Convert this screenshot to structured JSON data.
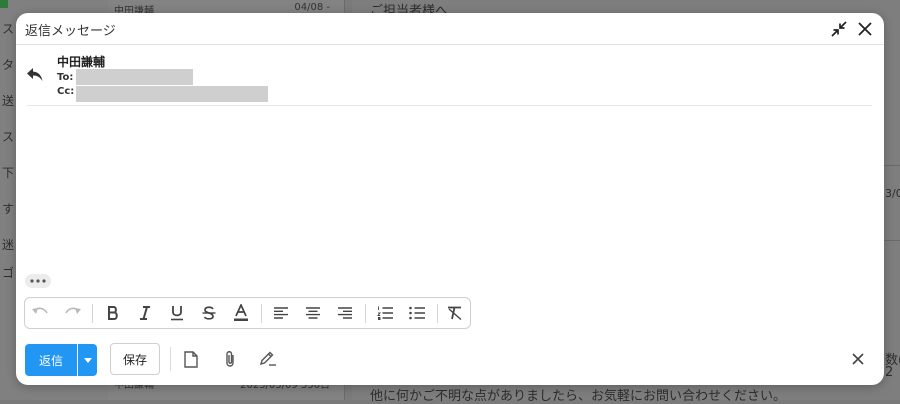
{
  "background": {
    "sidebar_items": [
      "ス",
      "タ",
      "送",
      "ス",
      "下",
      "す",
      "迷",
      "ゴ"
    ],
    "list_items": [
      {
        "name": "中田謙輔",
        "date": "04/08 -"
      },
      {
        "name": "中田謙輔",
        "date": "2023/03/09 336日"
      }
    ],
    "preview_lines": [
      "ご担当者様へ",
      "他に何かご不明な点がありましたら、お気軽にお問い合わせください。"
    ],
    "right_fragments": [
      "3/09",
      "数(",
      "2"
    ]
  },
  "modal": {
    "title": "返信メッセージ",
    "sender_name": "中田謙輔",
    "to_label": "To:",
    "cc_label": "Cc:",
    "body_text": ""
  },
  "toolbar": {
    "undo": "undo-icon",
    "redo": "redo-icon",
    "bold": "bold-icon",
    "italic": "italic-icon",
    "underline": "underline-icon",
    "strike": "strikethrough-icon",
    "font_color": "font-color-icon",
    "align_left": "align-left-icon",
    "align_center": "align-center-icon",
    "align_right": "align-right-icon",
    "ordered_list": "ordered-list-icon",
    "bullet_list": "bullet-list-icon",
    "clear_format": "clear-format-icon"
  },
  "footer": {
    "send_label": "返信",
    "save_label": "保存"
  },
  "colors": {
    "primary": "#2196f3",
    "overlay": "#7a7a7a",
    "redacted": "#cfcfcf"
  }
}
